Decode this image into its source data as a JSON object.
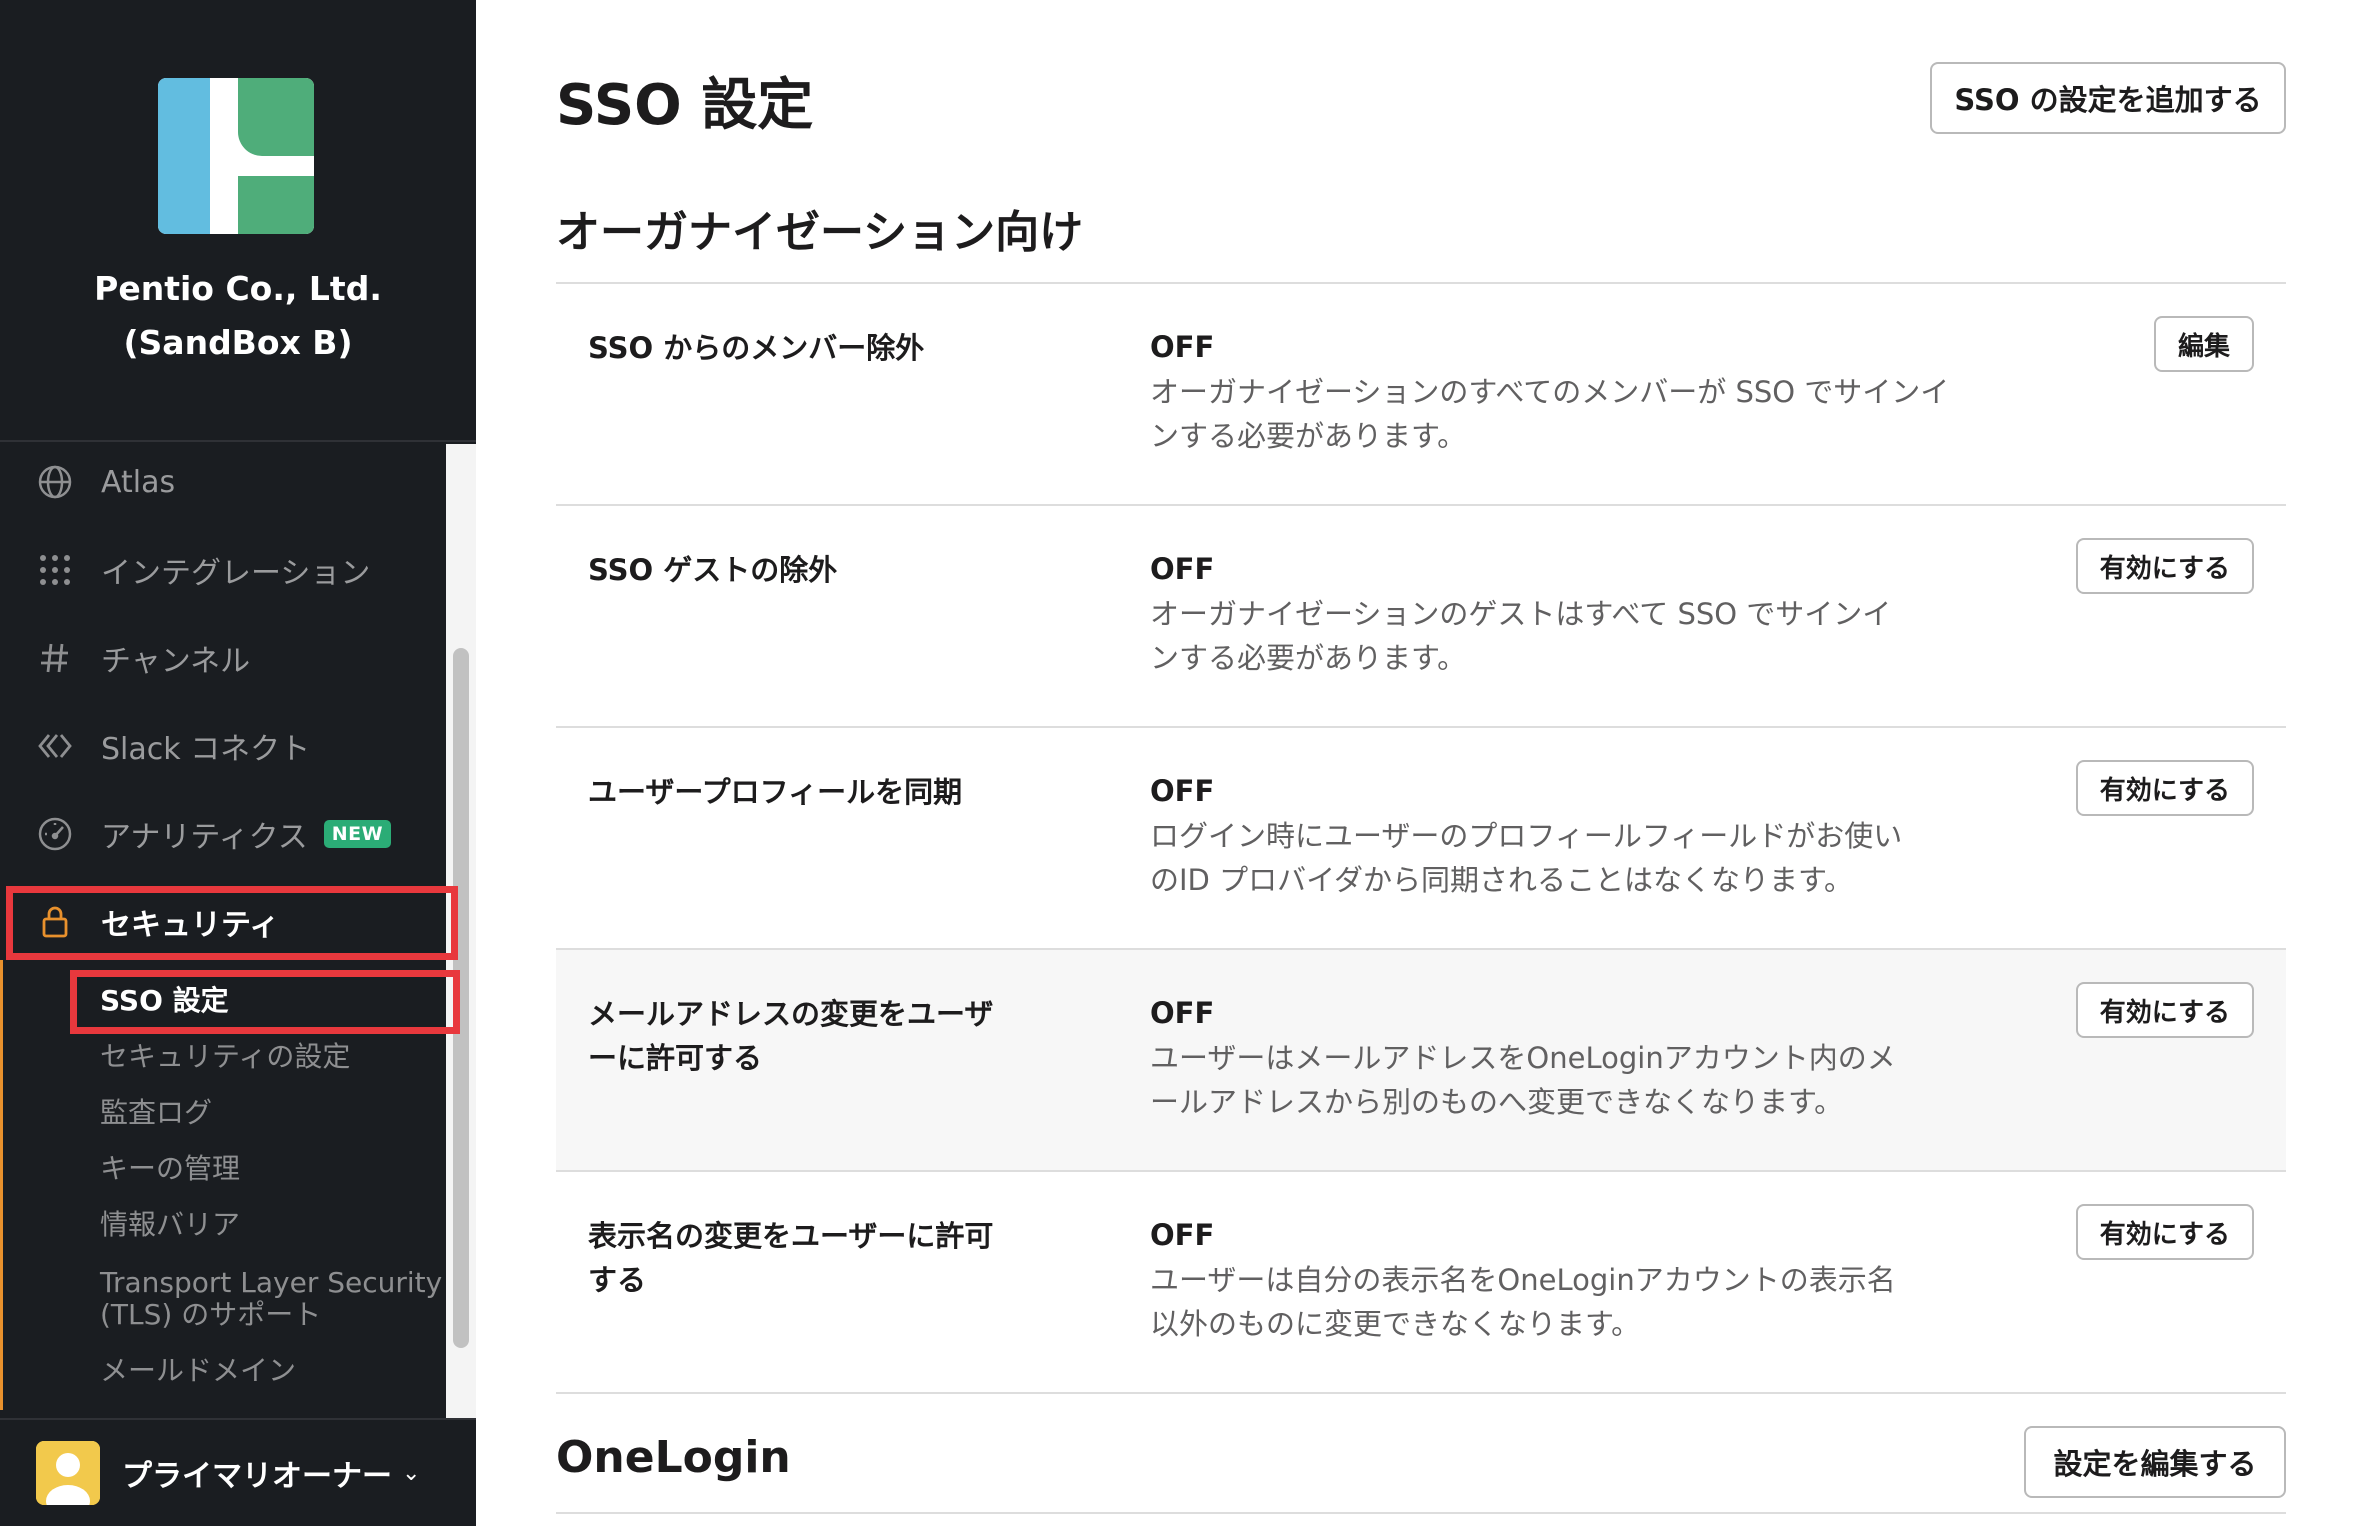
{
  "colors": {
    "sidebar_bg": "#1a1d21",
    "highlight_red": "#e8383d",
    "badge_green": "#2bac76",
    "logo_blue": "#62bde0",
    "logo_green": "#4fad7a"
  },
  "sidebar": {
    "org_name_line1": "Pentio Co., Ltd.",
    "org_name_line2": "(SandBox B)",
    "nav": [
      {
        "label": "Atlas",
        "icon": "globe-icon"
      },
      {
        "label": "インテグレーション",
        "icon": "grid-dots-icon"
      },
      {
        "label": "チャンネル",
        "icon": "hash-icon"
      },
      {
        "label": "Slack コネクト",
        "icon": "slack-connect-icon"
      },
      {
        "label": "アナリティクス",
        "icon": "gauge-icon",
        "badge": "NEW"
      },
      {
        "label": "セキュリティ",
        "icon": "lock-icon",
        "active": true
      }
    ],
    "sub_items": [
      {
        "label": "SSO 設定",
        "active": true
      },
      {
        "label": "セキュリティの設定"
      },
      {
        "label": "監査ログ"
      },
      {
        "label": "キーの管理"
      },
      {
        "label": "情報バリア"
      },
      {
        "label": "Transport Layer Security"
      },
      {
        "label": "(TLS) のサポート"
      },
      {
        "label": "メールドメイン"
      }
    ],
    "footer_name": "プライマリオーナー",
    "footer_chevron": "⌄"
  },
  "main": {
    "title": "SSO 設定",
    "add_button": "SSO の設定を追加する",
    "section_title": "オーガナイゼーション向け",
    "rows": [
      {
        "label": "SSO からのメンバー除外",
        "status": "OFF",
        "desc_line1": "オーガナイゼーションのすべてのメンバーが SSO でサインイ",
        "desc_line2": "ンする必要があります。",
        "button": "編集"
      },
      {
        "label": "SSO ゲストの除外",
        "status": "OFF",
        "desc_line1": "オーガナイゼーションのゲストはすべて SSO でサインイ",
        "desc_line2": "ンする必要があります。",
        "button": "有効にする"
      },
      {
        "label": "ユーザープロフィールを同期",
        "status": "OFF",
        "desc_line1": "ログイン時にユーザーのプロフィールフィールドがお使い",
        "desc_line2": "のID プロバイダから同期されることはなくなります。",
        "button": "有効にする"
      },
      {
        "label_line1": "メールアドレスの変更をユーザ",
        "label_line2": "ーに許可する",
        "status": "OFF",
        "desc_line1": "ユーザーはメールアドレスをOneLoginアカウント内のメ",
        "desc_line2": "ールアドレスから別のものへ変更できなくなります。",
        "button": "有効にする"
      },
      {
        "label_line1": "表示名の変更をユーザーに許可",
        "label_line2": "する",
        "status": "OFF",
        "desc_line1": "ユーザーは自分の表示名をOneLoginアカウントの表示名",
        "desc_line2": "以外のものに変更できなくなります。",
        "button": "有効にする"
      }
    ],
    "onelogin_title": "OneLogin",
    "edit_settings_button": "設定を編集する"
  }
}
